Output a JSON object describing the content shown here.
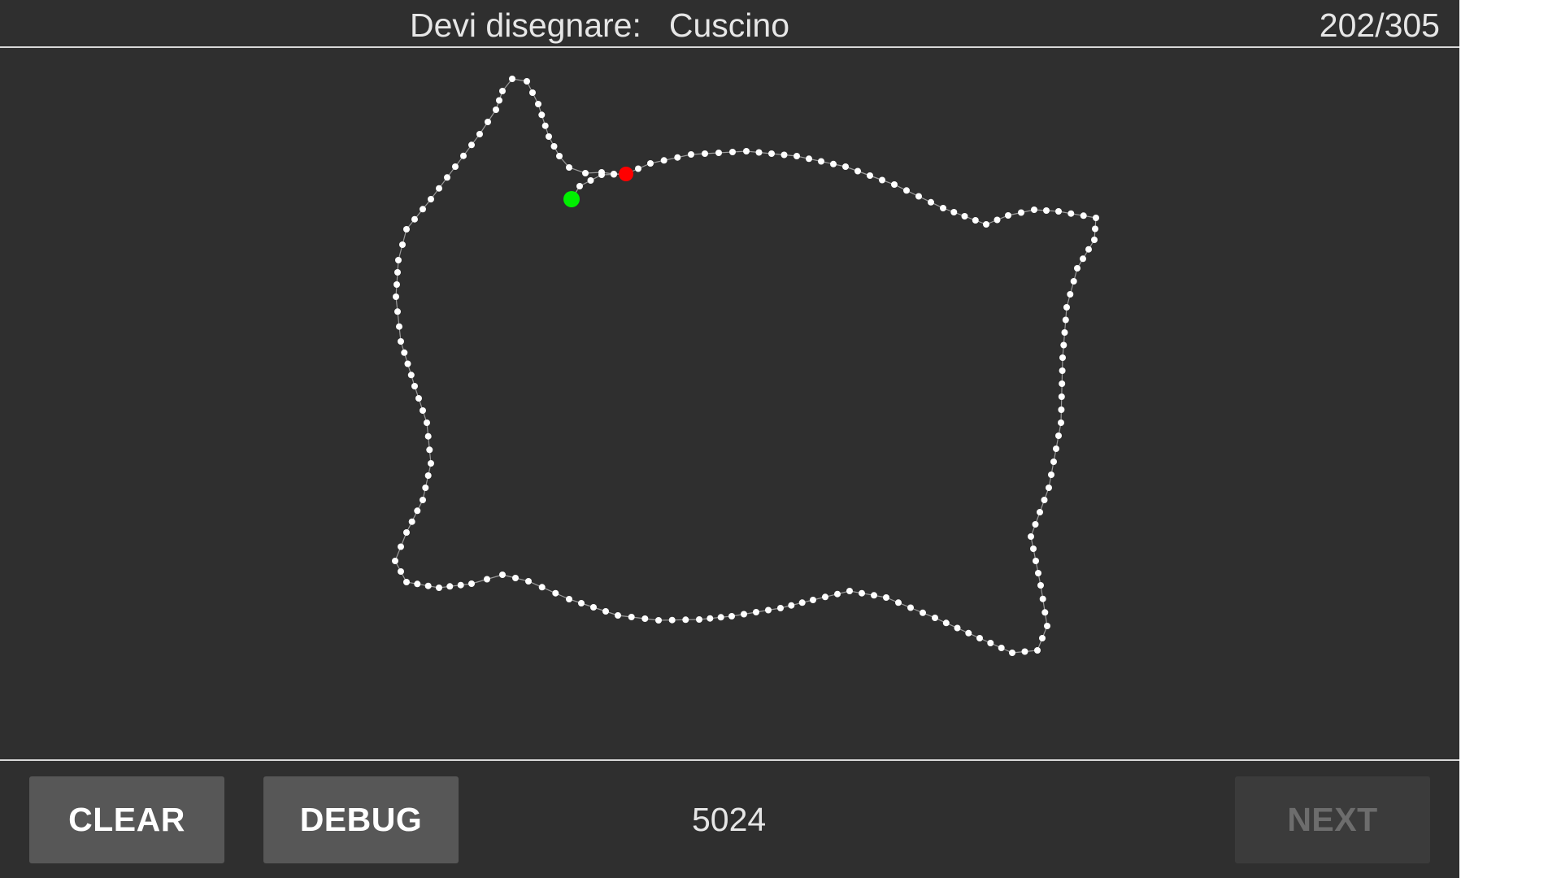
{
  "header": {
    "prompt_label": "Devi disegnare:",
    "prompt_word": "Cuscino",
    "progress": "202/305"
  },
  "drawing": {
    "stroke_color": "#ffffff",
    "line_color": "#9a9a9a",
    "start_marker_color": "#00ee00",
    "end_marker_color": "#ff0000"
  },
  "footer": {
    "clear_label": "CLEAR",
    "debug_label": "DEBUG",
    "score": "5024",
    "next_label": "NEXT"
  },
  "colors": {
    "background": "#2f2f2f",
    "button": "#575757",
    "button_disabled": "#3b3b3b"
  }
}
